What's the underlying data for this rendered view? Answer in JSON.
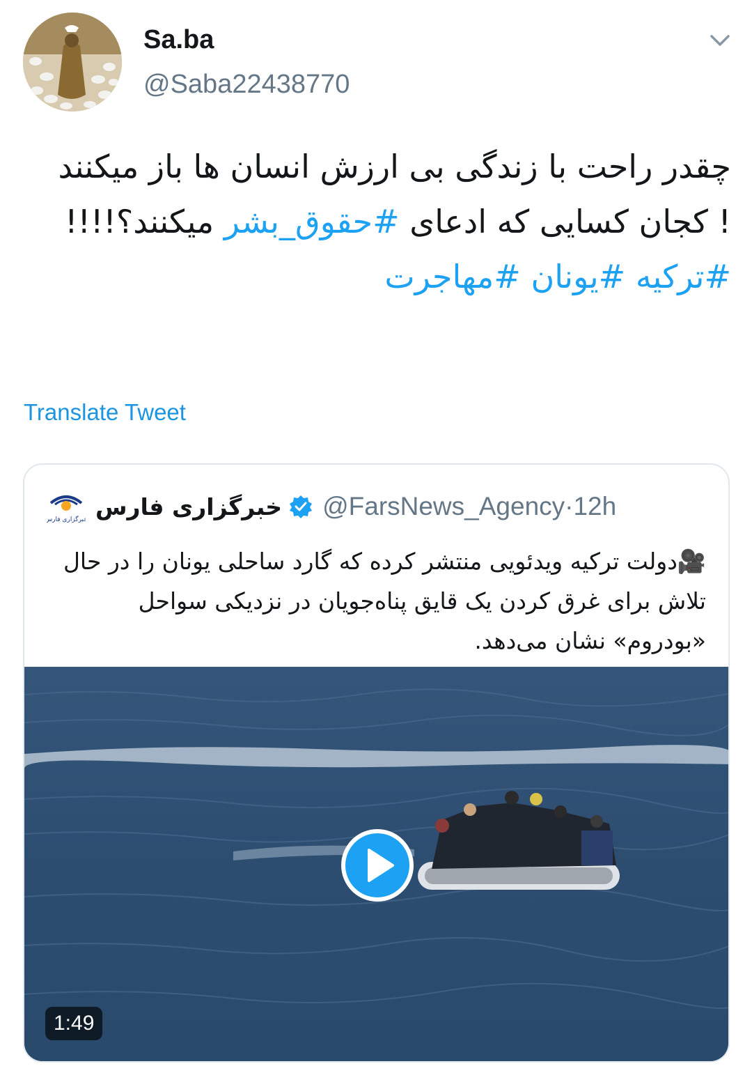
{
  "tweet": {
    "author": {
      "display_name": "Sa.ba",
      "handle": "@Saba22438770",
      "avatar_icon": "avatar-woman-with-doves"
    },
    "more_icon": "chevron-down-icon",
    "text_plain_1": "چقدر راحت با زندگی بی ارزش انسان ها باز میکنند ! کجان کسایی که ادعای ",
    "text_hashtag_1": "#حقوق_بشر",
    "text_plain_2": " میکنند؟!!!!",
    "hashtags_line": [
      "#ترکیه",
      "#یونان",
      "#مهاجرت"
    ],
    "translate_label": "Translate Tweet"
  },
  "quoted_tweet": {
    "display_name": "خبرگزاری فارس",
    "verified": true,
    "handle": "@FarsNews_Agency",
    "time": "12h",
    "separator": " · ",
    "emoji": "🎥",
    "text": "دولت ترکیه ویدئویی منتشر کرده که گارد ساحلی یونان را در حال تلاش برای غرق کردن یک قایق پناه‌جویان در نزدیکی سواحل «بودروم» نشان می‌دهد.",
    "media": {
      "type": "video",
      "duration": "1:49",
      "play_icon": "play-icon"
    }
  },
  "colors": {
    "link": "#1da1f2",
    "secondary_text": "#657786",
    "border": "#e1e8ed"
  }
}
